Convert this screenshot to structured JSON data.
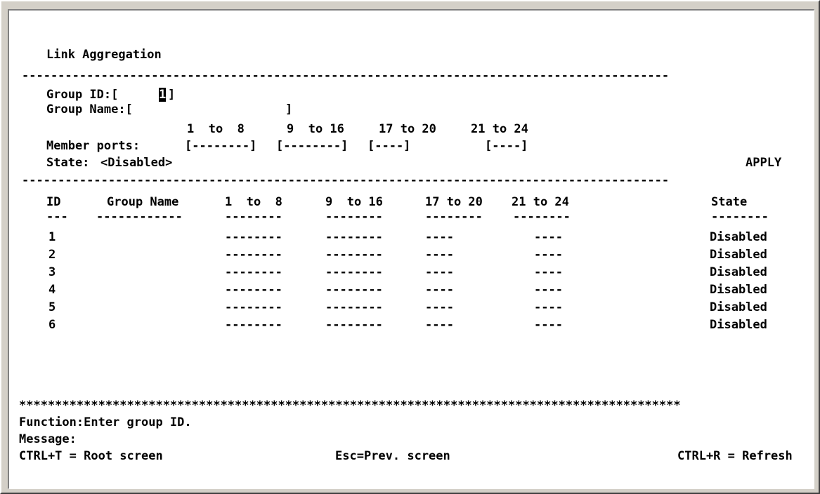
{
  "title": "Link Aggregation",
  "divider_dashes": "------------------------------------------------------------------------------------------",
  "form": {
    "group_id_label": "Group ID:[",
    "group_id_value": "1",
    "group_id_close": "]",
    "group_name_label": "Group Name:[",
    "group_name_value": "",
    "group_name_close": "]",
    "range_1": "1  to  8",
    "range_2": "9  to 16",
    "range_3": "17 to 20",
    "range_4": "21 to 24",
    "member_ports_label": "Member ports:",
    "port_1": "[--------]",
    "port_2": "[--------]",
    "port_3": "[----]",
    "port_4": "[----]",
    "state_label": "State:",
    "state_value": "<Disabled>",
    "apply_label": "APPLY"
  },
  "table": {
    "headers": {
      "id": "ID",
      "group_name": "Group Name",
      "p1": "1  to  8",
      "p2": "9  to 16",
      "p3": "17 to 20",
      "p4": "21 to 24",
      "state": "State"
    },
    "underlines": {
      "id": "---",
      "group_name": "------------",
      "p1": "--------",
      "p2": "--------",
      "p3": "--------",
      "p4": "--------",
      "state": "--------"
    },
    "rows": [
      {
        "id": "1",
        "name": "",
        "p1": "--------",
        "p2": "--------",
        "p3": "----",
        "p4": "----",
        "state": "Disabled"
      },
      {
        "id": "2",
        "name": "",
        "p1": "--------",
        "p2": "--------",
        "p3": "----",
        "p4": "----",
        "state": "Disabled"
      },
      {
        "id": "3",
        "name": "",
        "p1": "--------",
        "p2": "--------",
        "p3": "----",
        "p4": "----",
        "state": "Disabled"
      },
      {
        "id": "4",
        "name": "",
        "p1": "--------",
        "p2": "--------",
        "p3": "----",
        "p4": "----",
        "state": "Disabled"
      },
      {
        "id": "5",
        "name": "",
        "p1": "--------",
        "p2": "--------",
        "p3": "----",
        "p4": "----",
        "state": "Disabled"
      },
      {
        "id": "6",
        "name": "",
        "p1": "--------",
        "p2": "--------",
        "p3": "----",
        "p4": "----",
        "state": "Disabled"
      }
    ]
  },
  "footer": {
    "stars": "********************************************************************************************",
    "function_text": "Function:Enter group ID.",
    "message_text": "Message:",
    "root_screen": "CTRL+T = Root screen",
    "prev_screen": "Esc=Prev. screen",
    "refresh": "CTRL+R = Refresh"
  }
}
